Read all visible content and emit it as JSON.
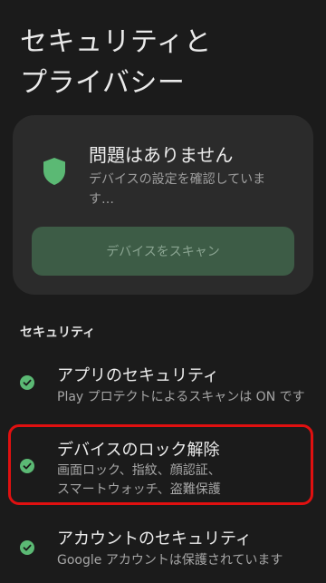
{
  "page": {
    "title": "セキュリティと\nプライバシー"
  },
  "status_card": {
    "title": "問題はありません",
    "subtitle": "デバイスの設定を確認していま す…",
    "scan_button": "デバイスをスキャン",
    "shield_color": "#5bb974"
  },
  "security": {
    "header": "セキュリティ",
    "items": [
      {
        "title": "アプリのセキュリティ",
        "subtitle": "Play プロテクトによるスキャンは ON です",
        "icon": "check-circle-icon"
      },
      {
        "title": "デバイスのロック解除",
        "subtitle": "画面ロック、指紋、顔認証、\nスマートウォッチ、盗難保護",
        "icon": "check-circle-icon"
      },
      {
        "title": "アカウントのセキュリティ",
        "subtitle": "Google アカウントは保護されています",
        "icon": "check-circle-icon"
      }
    ]
  },
  "colors": {
    "accent": "#5bb974",
    "highlight": "#e01010",
    "background": "#1b1b1b"
  }
}
